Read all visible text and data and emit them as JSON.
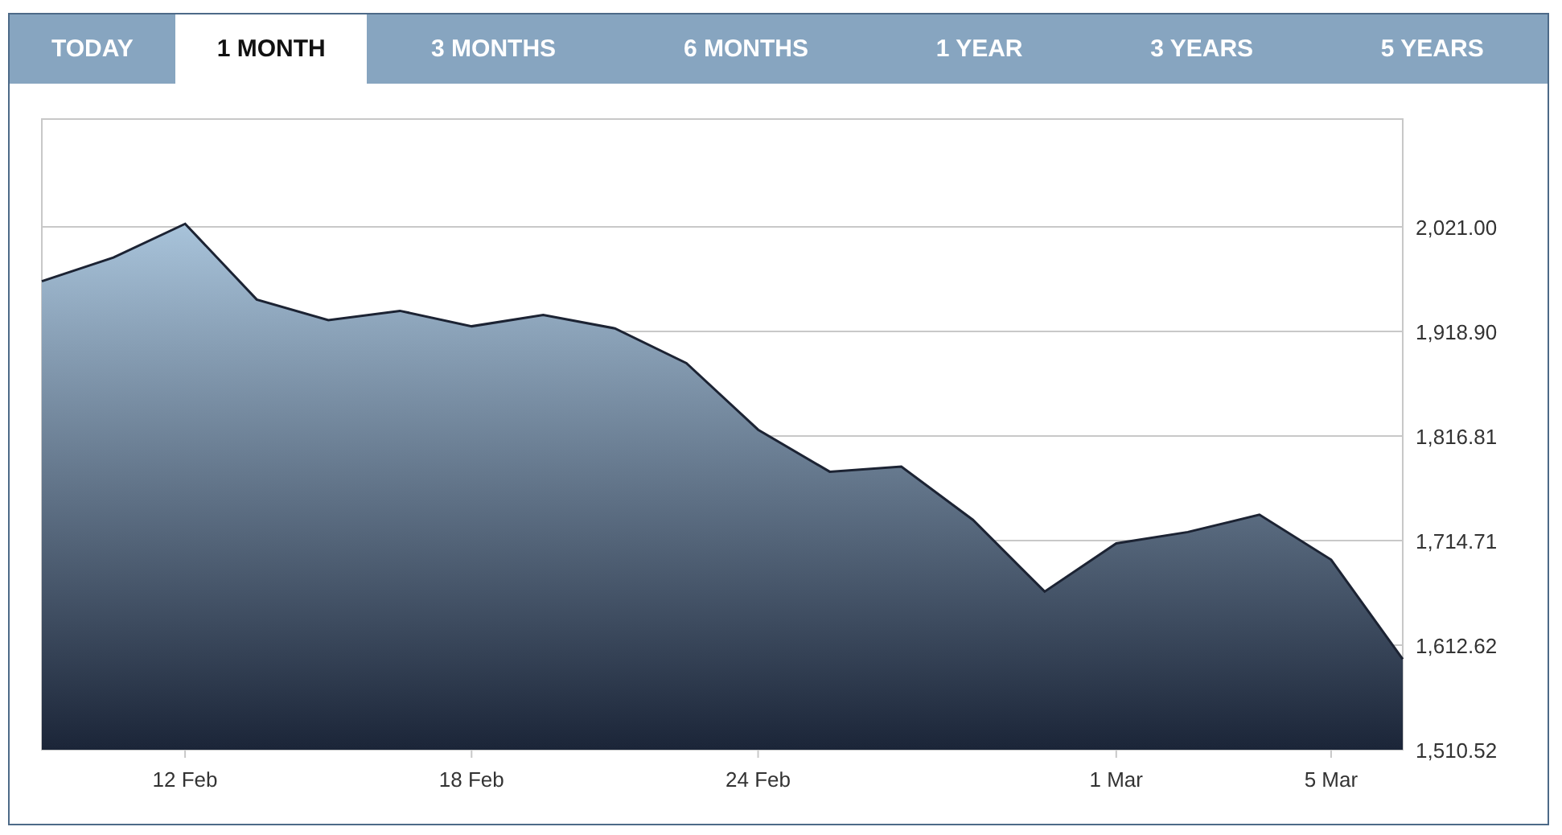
{
  "tabs": [
    {
      "label": "TODAY",
      "selected": false
    },
    {
      "label": "1 MONTH",
      "selected": true
    },
    {
      "label": "3 MONTHS",
      "selected": false
    },
    {
      "label": "6 MONTHS",
      "selected": false
    },
    {
      "label": "1 YEAR",
      "selected": false
    },
    {
      "label": "3 YEARS",
      "selected": false
    },
    {
      "label": "5 YEARS",
      "selected": false
    }
  ],
  "chart": {
    "chart_data": {
      "type": "area",
      "categories": [
        null,
        null,
        "12 Feb",
        null,
        null,
        null,
        "18 Feb",
        null,
        null,
        null,
        "24 Feb",
        null,
        null,
        null,
        null,
        "1 Mar",
        null,
        null,
        "5 Mar",
        null
      ],
      "series": [
        {
          "color": "#1c2333",
          "values": [
            1968,
            1991,
            2024,
            1950,
            1930,
            1939,
            1924,
            1935,
            1922,
            1888,
            1823,
            1782,
            1787,
            1735,
            1665,
            1712,
            1723,
            1740,
            1696,
            1599
          ]
        }
      ],
      "ylim": [
        1510.52,
        2126.3
      ],
      "grid": true,
      "yticks": [
        {
          "value": 1510.52,
          "label": "1,510.52"
        },
        {
          "value": 1612.62,
          "label": "1,612.62"
        },
        {
          "value": 1714.71,
          "label": "1,714.71"
        },
        {
          "value": 1816.81,
          "label": "1,816.81"
        },
        {
          "value": 1918.9,
          "label": "1,918.90"
        },
        {
          "value": 2021.0,
          "label": "2,021.00"
        }
      ]
    }
  }
}
